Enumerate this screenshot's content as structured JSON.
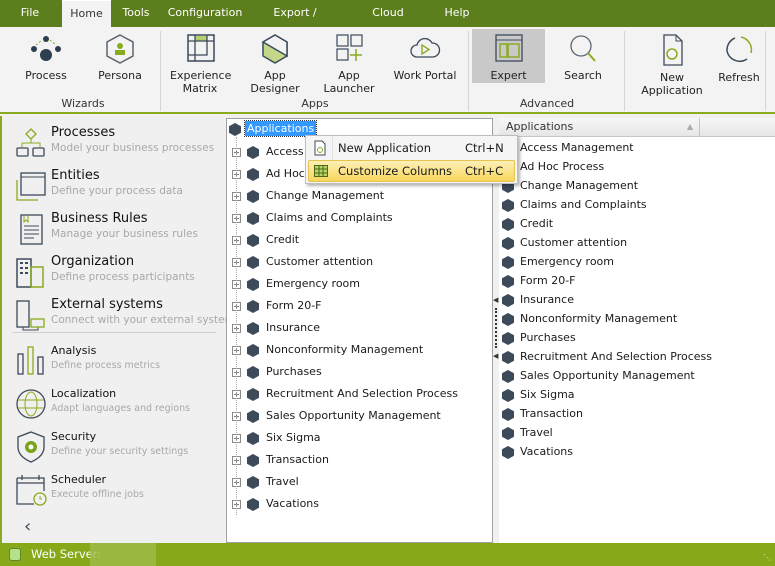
{
  "menu": {
    "tabs": [
      {
        "label": "File"
      },
      {
        "label": "Home",
        "active": true
      },
      {
        "label": "Tools"
      },
      {
        "label": "Configuration"
      },
      {
        "label": "Export / Import"
      },
      {
        "label": "Cloud Services"
      },
      {
        "label": "Help"
      }
    ]
  },
  "ribbon": {
    "groups": {
      "wizards": "Wizards",
      "apps": "Apps",
      "advanced": "Advanced"
    },
    "buttons": {
      "process": "Process",
      "persona": "Persona",
      "experience_matrix_1": "Experience",
      "experience_matrix_2": "Matrix",
      "app_designer": "App Designer",
      "app_launcher": "App Launcher",
      "work_portal": "Work Portal",
      "expert": "Expert",
      "search": "Search",
      "new_application": "New Application",
      "refresh": "Refresh"
    }
  },
  "sidebar": {
    "items": [
      {
        "title": "Processes",
        "subtitle": "Model your business processes"
      },
      {
        "title": "Entities",
        "subtitle": "Define your process data"
      },
      {
        "title": "Business Rules",
        "subtitle": "Manage your business rules"
      },
      {
        "title": "Organization",
        "subtitle": "Define process participants"
      },
      {
        "title": "External systems",
        "subtitle": "Connect with your external systems"
      },
      {
        "title": "Analysis",
        "subtitle": "Define process metrics"
      },
      {
        "title": "Localization",
        "subtitle": "Adapt languages and regions"
      },
      {
        "title": "Security",
        "subtitle": "Define your security settings"
      },
      {
        "title": "Scheduler",
        "subtitle": "Execute offline jobs"
      }
    ]
  },
  "tree": {
    "root": "Applications",
    "items": [
      "Access Management",
      "Ad Hoc Process",
      "Change Management",
      "Claims and Complaints",
      "Credit",
      "Customer attention",
      "Emergency room",
      "Form 20-F",
      "Insurance",
      "Nonconformity Management",
      "Purchases",
      "Recruitment And Selection Process",
      "Sales Opportunity Management",
      "Six Sigma",
      "Transaction",
      "Travel",
      "Vacations"
    ]
  },
  "list": {
    "column": "Applications",
    "items": [
      "Access Management",
      "Ad Hoc Process",
      "Change Management",
      "Claims and Complaints",
      "Credit",
      "Customer attention",
      "Emergency room",
      "Form 20-F",
      "Insurance",
      "Nonconformity Management",
      "Purchases",
      "Recruitment And Selection Process",
      "Sales Opportunity Management",
      "Six Sigma",
      "Transaction",
      "Travel",
      "Vacations"
    ]
  },
  "context_menu": {
    "items": [
      {
        "label": "New Application",
        "shortcut": "Ctrl+N"
      },
      {
        "label": "Customize Columns",
        "shortcut": "Ctrl+C",
        "highlighted": true
      }
    ]
  },
  "status": {
    "web_server": "Web Server:"
  },
  "colors": {
    "brand_green": "#5d7e1c",
    "accent_lime": "#8aab1f",
    "status_bar": "#87a819",
    "highlight": "#f7d65c"
  }
}
